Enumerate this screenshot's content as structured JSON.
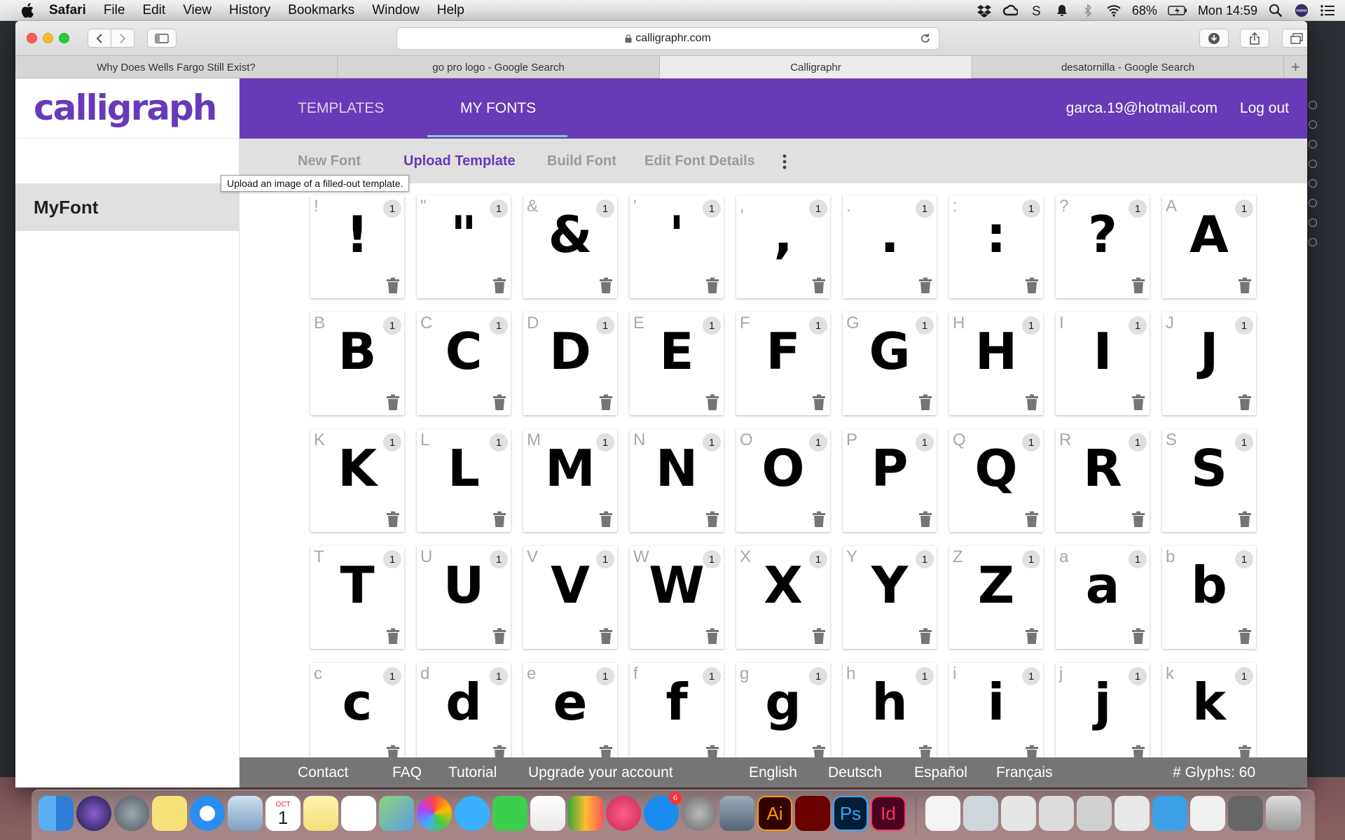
{
  "menubar": {
    "app": "Safari",
    "items": [
      "File",
      "Edit",
      "View",
      "History",
      "Bookmarks",
      "Window",
      "Help"
    ],
    "battery": "68%",
    "clock": "Mon 14:59"
  },
  "browser": {
    "url": "calligraphr.com",
    "tabs": [
      {
        "label": "Why Does Wells Fargo Still Exist?",
        "active": false
      },
      {
        "label": "go pro logo - Google Search",
        "active": false
      },
      {
        "label": "Calligraphr",
        "active": true
      },
      {
        "label": "desatornilla - Google Search",
        "active": false
      }
    ],
    "new_tab": "+"
  },
  "app": {
    "logo": "calligraphr",
    "nav": {
      "templates": "TEMPLATES",
      "my_fonts": "MY FONTS",
      "email": "garca.19@hotmail.com",
      "logout": "Log out"
    },
    "subnav": {
      "new_font": "New Font",
      "upload": "Upload Template",
      "build": "Build Font",
      "edit": "Edit Font Details",
      "tooltip": "Upload an image of a filled-out template."
    },
    "sidebar": {
      "font_name": "MyFont"
    },
    "glyphs": [
      {
        "label": "!",
        "char": "!",
        "count": "1"
      },
      {
        "label": "\"",
        "char": "\"",
        "count": "1"
      },
      {
        "label": "&",
        "char": "&",
        "count": "1"
      },
      {
        "label": "'",
        "char": "'",
        "count": "1"
      },
      {
        "label": ",",
        "char": ",",
        "count": "1"
      },
      {
        "label": ".",
        "char": ".",
        "count": "1"
      },
      {
        "label": ":",
        "char": ":",
        "count": "1"
      },
      {
        "label": "?",
        "char": "?",
        "count": "1"
      },
      {
        "label": "A",
        "char": "A",
        "count": "1"
      },
      {
        "label": "B",
        "char": "B",
        "count": "1"
      },
      {
        "label": "C",
        "char": "C",
        "count": "1"
      },
      {
        "label": "D",
        "char": "D",
        "count": "1"
      },
      {
        "label": "E",
        "char": "E",
        "count": "1"
      },
      {
        "label": "F",
        "char": "F",
        "count": "1"
      },
      {
        "label": "G",
        "char": "G",
        "count": "1"
      },
      {
        "label": "H",
        "char": "H",
        "count": "1"
      },
      {
        "label": "I",
        "char": "I",
        "count": "1"
      },
      {
        "label": "J",
        "char": "J",
        "count": "1"
      },
      {
        "label": "K",
        "char": "K",
        "count": "1"
      },
      {
        "label": "L",
        "char": "L",
        "count": "1"
      },
      {
        "label": "M",
        "char": "M",
        "count": "1"
      },
      {
        "label": "N",
        "char": "N",
        "count": "1"
      },
      {
        "label": "O",
        "char": "O",
        "count": "1"
      },
      {
        "label": "P",
        "char": "P",
        "count": "1"
      },
      {
        "label": "Q",
        "char": "Q",
        "count": "1"
      },
      {
        "label": "R",
        "char": "R",
        "count": "1"
      },
      {
        "label": "S",
        "char": "S",
        "count": "1"
      },
      {
        "label": "T",
        "char": "T",
        "count": "1"
      },
      {
        "label": "U",
        "char": "U",
        "count": "1"
      },
      {
        "label": "V",
        "char": "V",
        "count": "1"
      },
      {
        "label": "W",
        "char": "W",
        "count": "1"
      },
      {
        "label": "X",
        "char": "X",
        "count": "1"
      },
      {
        "label": "Y",
        "char": "Y",
        "count": "1"
      },
      {
        "label": "Z",
        "char": "Z",
        "count": "1"
      },
      {
        "label": "a",
        "char": "a",
        "count": "1"
      },
      {
        "label": "b",
        "char": "b",
        "count": "1"
      },
      {
        "label": "c",
        "char": "c",
        "count": "1"
      },
      {
        "label": "d",
        "char": "d",
        "count": "1"
      },
      {
        "label": "e",
        "char": "e",
        "count": "1"
      },
      {
        "label": "f",
        "char": "f",
        "count": "1"
      },
      {
        "label": "g",
        "char": "g",
        "count": "1"
      },
      {
        "label": "h",
        "char": "h",
        "count": "1"
      },
      {
        "label": "i",
        "char": "i",
        "count": "1"
      },
      {
        "label": "j",
        "char": "j",
        "count": "1"
      },
      {
        "label": "k",
        "char": "k",
        "count": "1"
      }
    ],
    "footer": {
      "contact": "Contact",
      "faq": "FAQ",
      "tutorial": "Tutorial",
      "upgrade": "Upgrade your account",
      "lang_en": "English",
      "lang_de": "Deutsch",
      "lang_es": "Español",
      "lang_fr": "Français",
      "glyph_count": "# Glyphs: 60"
    }
  },
  "dock": {
    "badge_appstore": "6",
    "calendar_month": "OCT",
    "calendar_day": "1",
    "illustrator": "Ai",
    "photoshop": "Ps",
    "indesign": "Id"
  },
  "colors": {
    "brand_purple": "#673ab7",
    "nav_underline": "#80cbc4",
    "footer_gray": "#757575"
  }
}
